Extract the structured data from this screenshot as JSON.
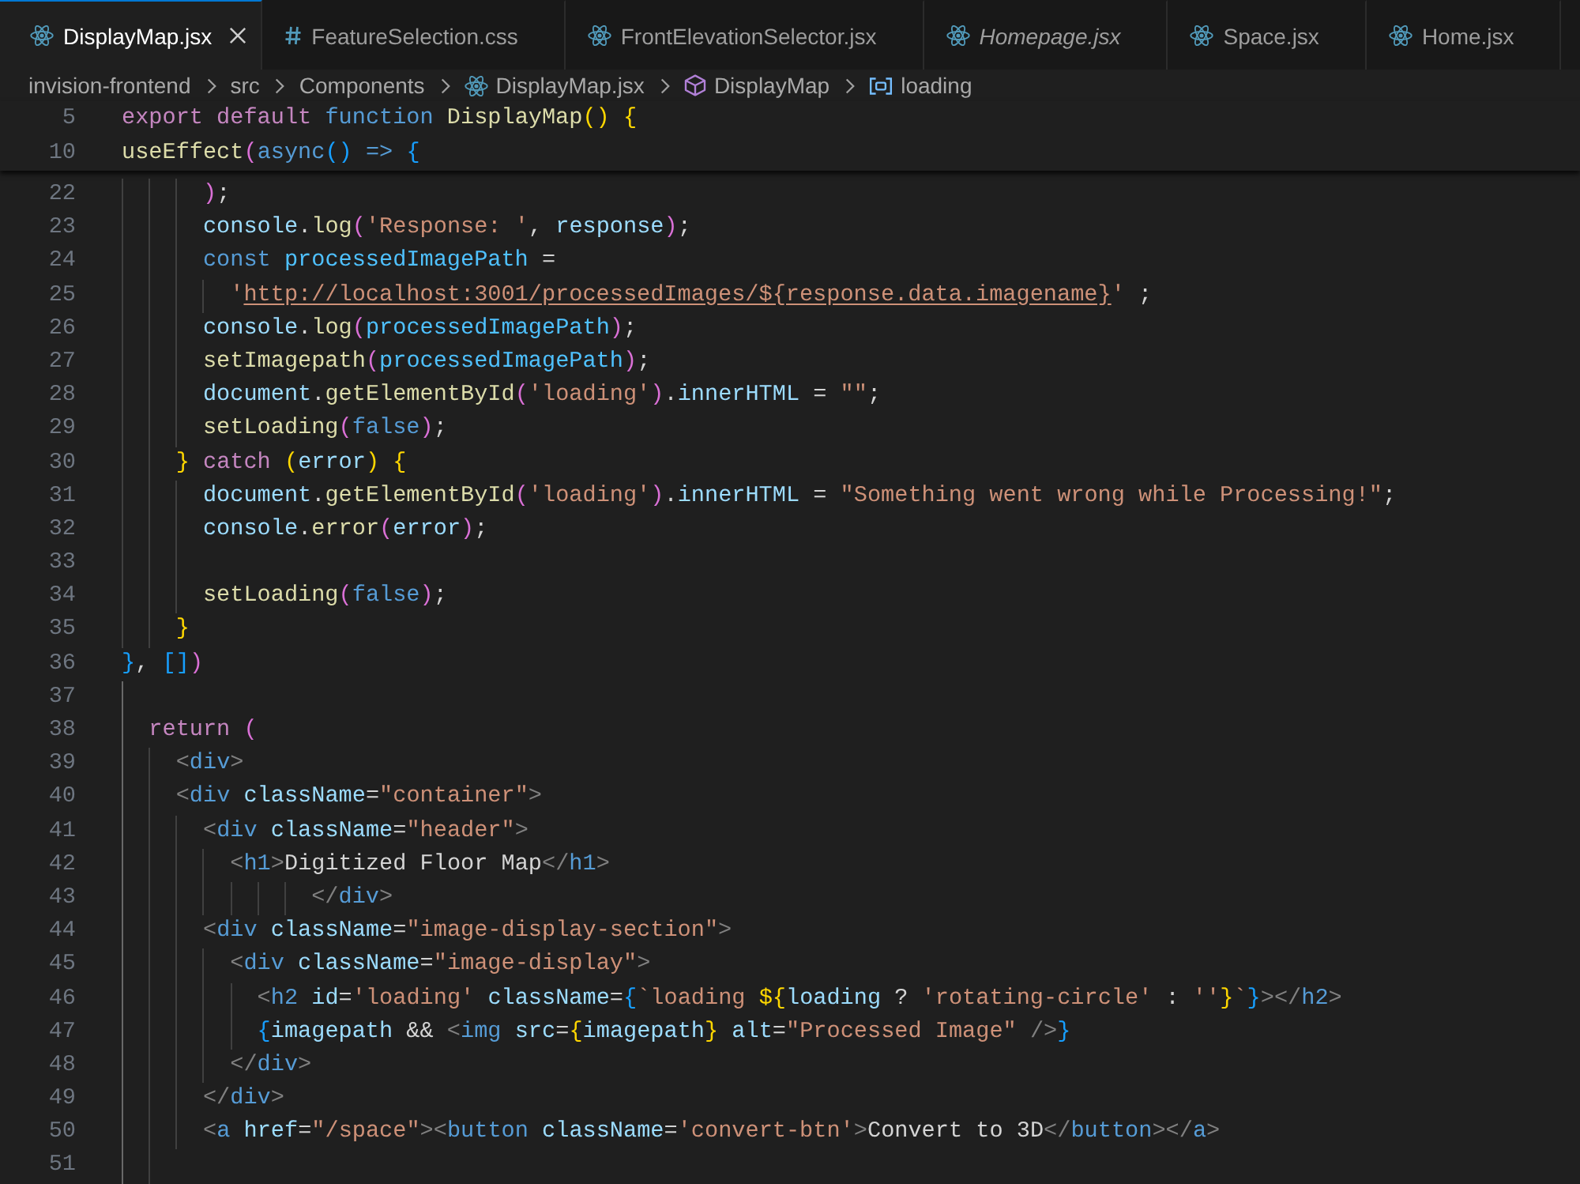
{
  "tabs": [
    {
      "label": "DisplayMap.jsx",
      "kind": "jsx",
      "selected": true,
      "preview": false
    },
    {
      "label": "FeatureSelection.css",
      "kind": "css",
      "selected": false,
      "preview": false
    },
    {
      "label": "FrontElevationSelector.jsx",
      "kind": "jsx",
      "selected": false,
      "preview": false
    },
    {
      "label": "Homepage.jsx",
      "kind": "jsx",
      "selected": false,
      "preview": true
    },
    {
      "label": "Space.jsx",
      "kind": "jsx",
      "selected": false,
      "preview": false
    },
    {
      "label": "Home.jsx",
      "kind": "jsx",
      "selected": false,
      "preview": false
    }
  ],
  "breadcrumbs": [
    {
      "label": "invision-frontend",
      "kind": "folder"
    },
    {
      "label": "src",
      "kind": "folder"
    },
    {
      "label": "Components",
      "kind": "folder"
    },
    {
      "label": "DisplayMap.jsx",
      "kind": "jsx"
    },
    {
      "label": "DisplayMap",
      "kind": "function"
    },
    {
      "label": "loading",
      "kind": "variable"
    }
  ],
  "sticky_lines": [
    {
      "number": "5",
      "tokens": [
        {
          "kind": "keyword",
          "text": "export default"
        },
        {
          "kind": "storage",
          "text": " function"
        },
        {
          "kind": "function",
          "text": " DisplayMap"
        },
        {
          "kind": "bracket1",
          "text": "()"
        },
        {
          "kind": "bracket1",
          "text": " {"
        }
      ]
    },
    {
      "number": "10",
      "tokens": [
        {
          "kind": "function",
          "text": "useEffect"
        },
        {
          "kind": "bracket2",
          "text": "("
        },
        {
          "kind": "storage",
          "text": "async"
        },
        {
          "kind": "bracket3",
          "text": "()"
        },
        {
          "kind": "storage",
          "text": " => "
        },
        {
          "kind": "bracket3",
          "text": "{"
        }
      ]
    }
  ],
  "lines": [
    {
      "number": "22",
      "guides": [
        {
          "active": false
        },
        {
          "active": false
        },
        {
          "active": false
        }
      ],
      "tokens": [
        {
          "kind": "bracket2",
          "text": ")"
        },
        {
          "kind": "plain",
          "text": ";"
        }
      ]
    },
    {
      "number": "23",
      "guides": [
        {
          "active": false
        },
        {
          "active": false
        },
        {
          "active": false
        }
      ],
      "tokens": [
        {
          "kind": "variable",
          "text": "console"
        },
        {
          "kind": "plain",
          "text": "."
        },
        {
          "kind": "function",
          "text": "log"
        },
        {
          "kind": "bracket2",
          "text": "("
        },
        {
          "kind": "string",
          "text": "'Response: '"
        },
        {
          "kind": "plain",
          "text": ", "
        },
        {
          "kind": "variable",
          "text": "response"
        },
        {
          "kind": "bracket2",
          "text": ")"
        },
        {
          "kind": "plain",
          "text": ";"
        }
      ]
    },
    {
      "number": "24",
      "guides": [
        {
          "active": false
        },
        {
          "active": false
        },
        {
          "active": false
        }
      ],
      "tokens": [
        {
          "kind": "storage",
          "text": "const"
        },
        {
          "kind": "constant",
          "text": " processedImagePath"
        },
        {
          "kind": "plain",
          "text": " ="
        }
      ]
    },
    {
      "number": "25",
      "guides": [
        {
          "active": false
        },
        {
          "active": false
        },
        {
          "active": false
        },
        {
          "active": false
        }
      ],
      "tokens": [
        {
          "kind": "string",
          "text": "'"
        },
        {
          "kind": "link",
          "text": "http://localhost:3001/processedImages/${response.data.imagename}"
        },
        {
          "kind": "string",
          "text": "'"
        },
        {
          "kind": "plain",
          "text": " ;"
        }
      ]
    },
    {
      "number": "26",
      "guides": [
        {
          "active": false
        },
        {
          "active": false
        },
        {
          "active": false
        }
      ],
      "tokens": [
        {
          "kind": "variable",
          "text": "console"
        },
        {
          "kind": "plain",
          "text": "."
        },
        {
          "kind": "function",
          "text": "log"
        },
        {
          "kind": "bracket2",
          "text": "("
        },
        {
          "kind": "constant",
          "text": "processedImagePath"
        },
        {
          "kind": "bracket2",
          "text": ")"
        },
        {
          "kind": "plain",
          "text": ";"
        }
      ]
    },
    {
      "number": "27",
      "guides": [
        {
          "active": false
        },
        {
          "active": false
        },
        {
          "active": false
        }
      ],
      "tokens": [
        {
          "kind": "function",
          "text": "setImagepath"
        },
        {
          "kind": "bracket2",
          "text": "("
        },
        {
          "kind": "constant",
          "text": "processedImagePath"
        },
        {
          "kind": "bracket2",
          "text": ")"
        },
        {
          "kind": "plain",
          "text": ";"
        }
      ]
    },
    {
      "number": "28",
      "guides": [
        {
          "active": false
        },
        {
          "active": false
        },
        {
          "active": false
        }
      ],
      "tokens": [
        {
          "kind": "variable",
          "text": "document"
        },
        {
          "kind": "plain",
          "text": "."
        },
        {
          "kind": "function",
          "text": "getElementById"
        },
        {
          "kind": "bracket2",
          "text": "("
        },
        {
          "kind": "string",
          "text": "'loading'"
        },
        {
          "kind": "bracket2",
          "text": ")"
        },
        {
          "kind": "plain",
          "text": "."
        },
        {
          "kind": "variable",
          "text": "innerHTML"
        },
        {
          "kind": "plain",
          "text": " = "
        },
        {
          "kind": "string",
          "text": "\"\""
        },
        {
          "kind": "plain",
          "text": ";"
        }
      ]
    },
    {
      "number": "29",
      "guides": [
        {
          "active": false
        },
        {
          "active": false
        },
        {
          "active": false
        }
      ],
      "tokens": [
        {
          "kind": "function",
          "text": "setLoading"
        },
        {
          "kind": "bracket2",
          "text": "("
        },
        {
          "kind": "literal",
          "text": "false"
        },
        {
          "kind": "bracket2",
          "text": ")"
        },
        {
          "kind": "plain",
          "text": ";"
        }
      ]
    },
    {
      "number": "30",
      "guides": [
        {
          "active": false
        },
        {
          "active": false
        }
      ],
      "tokens": [
        {
          "kind": "bracket1",
          "text": "}"
        },
        {
          "kind": "keyword",
          "text": " catch"
        },
        {
          "kind": "bracket1",
          "text": " ("
        },
        {
          "kind": "variable",
          "text": "error"
        },
        {
          "kind": "bracket1",
          "text": ")"
        },
        {
          "kind": "bracket1",
          "text": " {"
        }
      ]
    },
    {
      "number": "31",
      "guides": [
        {
          "active": false
        },
        {
          "active": false
        },
        {
          "active": false
        }
      ],
      "tokens": [
        {
          "kind": "variable",
          "text": "document"
        },
        {
          "kind": "plain",
          "text": "."
        },
        {
          "kind": "function",
          "text": "getElementById"
        },
        {
          "kind": "bracket2",
          "text": "("
        },
        {
          "kind": "string",
          "text": "'loading'"
        },
        {
          "kind": "bracket2",
          "text": ")"
        },
        {
          "kind": "plain",
          "text": "."
        },
        {
          "kind": "variable",
          "text": "innerHTML"
        },
        {
          "kind": "plain",
          "text": " = "
        },
        {
          "kind": "string",
          "text": "\"Something went wrong while Processing!\""
        },
        {
          "kind": "plain",
          "text": ";"
        }
      ]
    },
    {
      "number": "32",
      "guides": [
        {
          "active": false
        },
        {
          "active": false
        },
        {
          "active": false
        }
      ],
      "tokens": [
        {
          "kind": "variable",
          "text": "console"
        },
        {
          "kind": "plain",
          "text": "."
        },
        {
          "kind": "function",
          "text": "error"
        },
        {
          "kind": "bracket2",
          "text": "("
        },
        {
          "kind": "variable",
          "text": "error"
        },
        {
          "kind": "bracket2",
          "text": ")"
        },
        {
          "kind": "plain",
          "text": ";"
        }
      ]
    },
    {
      "number": "33",
      "guides": [
        {
          "active": false
        },
        {
          "active": false
        },
        {
          "active": false
        }
      ]
    },
    {
      "number": "34",
      "guides": [
        {
          "active": false
        },
        {
          "active": false
        },
        {
          "active": false
        }
      ],
      "tokens": [
        {
          "kind": "function",
          "text": "setLoading"
        },
        {
          "kind": "bracket2",
          "text": "("
        },
        {
          "kind": "literal",
          "text": "false"
        },
        {
          "kind": "bracket2",
          "text": ")"
        },
        {
          "kind": "plain",
          "text": ";"
        }
      ]
    },
    {
      "number": "35",
      "guides": [
        {
          "active": false
        },
        {
          "active": false
        }
      ],
      "tokens": [
        {
          "kind": "bracket1",
          "text": "}"
        }
      ]
    },
    {
      "number": "36",
      "tokens": [
        {
          "kind": "bracket3",
          "text": "}"
        },
        {
          "kind": "plain",
          "text": ", "
        },
        {
          "kind": "bracket3",
          "text": "[]"
        },
        {
          "kind": "bracket2",
          "text": ")"
        }
      ]
    },
    {
      "number": "37",
      "guides": [
        {
          "active": true
        }
      ]
    },
    {
      "number": "38",
      "guides": [
        {
          "active": true
        }
      ],
      "tokens": [
        {
          "kind": "keyword",
          "text": "return"
        },
        {
          "kind": "bracket2",
          "text": " ("
        }
      ]
    },
    {
      "number": "39",
      "guides": [
        {
          "active": true
        },
        {
          "active": false
        }
      ],
      "tokens": [
        {
          "kind": "angle",
          "text": "<"
        },
        {
          "kind": "tag",
          "text": "div"
        },
        {
          "kind": "angle",
          "text": ">"
        }
      ]
    },
    {
      "number": "40",
      "guides": [
        {
          "active": true
        },
        {
          "active": false
        }
      ],
      "tokens": [
        {
          "kind": "angle",
          "text": "<"
        },
        {
          "kind": "tag",
          "text": "div"
        },
        {
          "kind": "attribute",
          "text": " className"
        },
        {
          "kind": "plain",
          "text": "="
        },
        {
          "kind": "string",
          "text": "\"container\""
        },
        {
          "kind": "angle",
          "text": ">"
        }
      ]
    },
    {
      "number": "41",
      "guides": [
        {
          "active": true
        },
        {
          "active": false
        },
        {
          "active": false
        }
      ],
      "tokens": [
        {
          "kind": "angle",
          "text": "<"
        },
        {
          "kind": "tag",
          "text": "div"
        },
        {
          "kind": "attribute",
          "text": " className"
        },
        {
          "kind": "plain",
          "text": "="
        },
        {
          "kind": "string",
          "text": "\"header\""
        },
        {
          "kind": "angle",
          "text": ">"
        }
      ]
    },
    {
      "number": "42",
      "guides": [
        {
          "active": true
        },
        {
          "active": false
        },
        {
          "active": false
        },
        {
          "active": false
        }
      ],
      "tokens": [
        {
          "kind": "angle",
          "text": "<"
        },
        {
          "kind": "tag",
          "text": "h1"
        },
        {
          "kind": "angle",
          "text": ">"
        },
        {
          "kind": "text",
          "text": "Digitized Floor Map"
        },
        {
          "kind": "angle",
          "text": "</"
        },
        {
          "kind": "tag",
          "text": "h1"
        },
        {
          "kind": "angle",
          "text": ">"
        }
      ]
    },
    {
      "number": "43",
      "guides": [
        {
          "active": true
        },
        {
          "active": false
        },
        {
          "active": false
        },
        {
          "active": false
        },
        {
          "active": false
        },
        {
          "active": false
        },
        {
          "active": false
        }
      ],
      "tokens": [
        {
          "kind": "angle",
          "text": "</"
        },
        {
          "kind": "tag",
          "text": "div"
        },
        {
          "kind": "angle",
          "text": ">"
        }
      ]
    },
    {
      "number": "44",
      "guides": [
        {
          "active": true
        },
        {
          "active": false
        },
        {
          "active": false
        }
      ],
      "tokens": [
        {
          "kind": "angle",
          "text": "<"
        },
        {
          "kind": "tag",
          "text": "div"
        },
        {
          "kind": "attribute",
          "text": " className"
        },
        {
          "kind": "plain",
          "text": "="
        },
        {
          "kind": "string",
          "text": "\"image-display-section\""
        },
        {
          "kind": "angle",
          "text": ">"
        }
      ]
    },
    {
      "number": "45",
      "guides": [
        {
          "active": true
        },
        {
          "active": false
        },
        {
          "active": false
        },
        {
          "active": false
        }
      ],
      "tokens": [
        {
          "kind": "angle",
          "text": "<"
        },
        {
          "kind": "tag",
          "text": "div"
        },
        {
          "kind": "attribute",
          "text": " className"
        },
        {
          "kind": "plain",
          "text": "="
        },
        {
          "kind": "string",
          "text": "\"image-display\""
        },
        {
          "kind": "angle",
          "text": ">"
        }
      ]
    },
    {
      "number": "46",
      "guides": [
        {
          "active": true
        },
        {
          "active": false
        },
        {
          "active": false
        },
        {
          "active": false
        },
        {
          "active": false
        }
      ],
      "tokens": [
        {
          "kind": "angle",
          "text": "<"
        },
        {
          "kind": "tag",
          "text": "h2"
        },
        {
          "kind": "attribute",
          "text": " id"
        },
        {
          "kind": "plain",
          "text": "="
        },
        {
          "kind": "string",
          "text": "'loading'"
        },
        {
          "kind": "attribute",
          "text": " className"
        },
        {
          "kind": "plain",
          "text": "="
        },
        {
          "kind": "bracket3",
          "text": "{"
        },
        {
          "kind": "string",
          "text": "`loading "
        },
        {
          "kind": "bracket1",
          "text": "${"
        },
        {
          "kind": "variable",
          "text": "loading"
        },
        {
          "kind": "plain",
          "text": " ? "
        },
        {
          "kind": "string",
          "text": "'rotating-circle'"
        },
        {
          "kind": "plain",
          "text": " : "
        },
        {
          "kind": "string",
          "text": "''"
        },
        {
          "kind": "bracket1",
          "text": "}"
        },
        {
          "kind": "string",
          "text": "`"
        },
        {
          "kind": "bracket3",
          "text": "}"
        },
        {
          "kind": "angle",
          "text": "></"
        },
        {
          "kind": "tag",
          "text": "h2"
        },
        {
          "kind": "angle",
          "text": ">"
        }
      ]
    },
    {
      "number": "47",
      "guides": [
        {
          "active": true
        },
        {
          "active": false
        },
        {
          "active": false
        },
        {
          "active": false
        },
        {
          "active": false
        }
      ],
      "tokens": [
        {
          "kind": "bracket3",
          "text": "{"
        },
        {
          "kind": "variable",
          "text": "imagepath"
        },
        {
          "kind": "plain",
          "text": " && "
        },
        {
          "kind": "angle",
          "text": "<"
        },
        {
          "kind": "tag",
          "text": "img"
        },
        {
          "kind": "attribute",
          "text": " src"
        },
        {
          "kind": "plain",
          "text": "="
        },
        {
          "kind": "bracket1",
          "text": "{"
        },
        {
          "kind": "variable",
          "text": "imagepath"
        },
        {
          "kind": "bracket1",
          "text": "}"
        },
        {
          "kind": "attribute",
          "text": " alt"
        },
        {
          "kind": "plain",
          "text": "="
        },
        {
          "kind": "string",
          "text": "\"Processed Image\""
        },
        {
          "kind": "angle",
          "text": " />"
        },
        {
          "kind": "bracket3",
          "text": "}"
        }
      ]
    },
    {
      "number": "48",
      "guides": [
        {
          "active": true
        },
        {
          "active": false
        },
        {
          "active": false
        },
        {
          "active": false
        }
      ],
      "tokens": [
        {
          "kind": "angle",
          "text": "</"
        },
        {
          "kind": "tag",
          "text": "div"
        },
        {
          "kind": "angle",
          "text": ">"
        }
      ]
    },
    {
      "number": "49",
      "guides": [
        {
          "active": true
        },
        {
          "active": false
        },
        {
          "active": false
        }
      ],
      "tokens": [
        {
          "kind": "angle",
          "text": "</"
        },
        {
          "kind": "tag",
          "text": "div"
        },
        {
          "kind": "angle",
          "text": ">"
        }
      ]
    },
    {
      "number": "50",
      "guides": [
        {
          "active": true
        },
        {
          "active": false
        },
        {
          "active": false
        }
      ],
      "tokens": [
        {
          "kind": "angle",
          "text": "<"
        },
        {
          "kind": "tag",
          "text": "a"
        },
        {
          "kind": "attribute",
          "text": " href"
        },
        {
          "kind": "plain",
          "text": "="
        },
        {
          "kind": "string",
          "text": "\"/space\""
        },
        {
          "kind": "angle",
          "text": "><"
        },
        {
          "kind": "tag",
          "text": "button"
        },
        {
          "kind": "attribute",
          "text": " className"
        },
        {
          "kind": "plain",
          "text": "="
        },
        {
          "kind": "string",
          "text": "'convert-btn'"
        },
        {
          "kind": "angle",
          "text": ">"
        },
        {
          "kind": "text",
          "text": "Convert to 3D"
        },
        {
          "kind": "angle",
          "text": "</"
        },
        {
          "kind": "tag",
          "text": "button"
        },
        {
          "kind": "angle",
          "text": "></"
        },
        {
          "kind": "tag",
          "text": "a"
        },
        {
          "kind": "angle",
          "text": ">"
        }
      ]
    },
    {
      "number": "51",
      "guides": [
        {
          "active": true
        },
        {
          "active": false
        }
      ]
    }
  ]
}
